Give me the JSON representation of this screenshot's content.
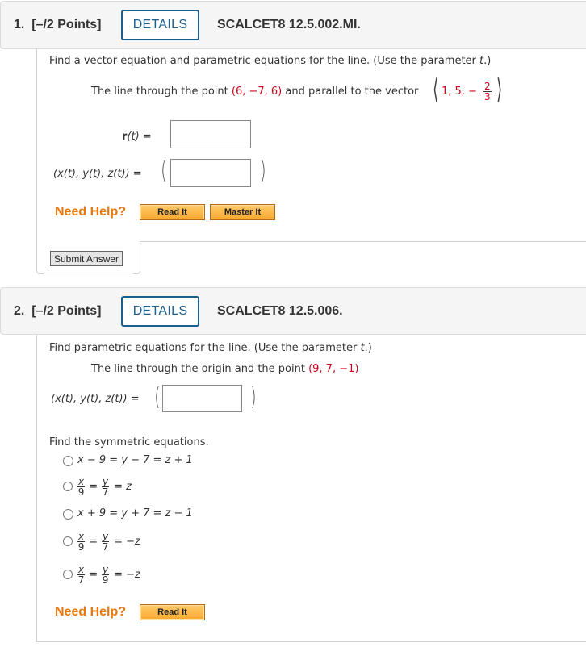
{
  "questions": [
    {
      "number": "1.",
      "points": "[–/2 Points]",
      "details_label": "DETAILS",
      "code": "SCALCET8 12.5.002.MI.",
      "instruction": "Find a vector equation and parametric equations for the line. (Use the parameter ",
      "instruction_param": "t",
      "instruction_end": ".)",
      "prompt_pre": "The line through the point ",
      "point": "(6, −7, 6)",
      "prompt_mid": " and parallel to the vector",
      "vector_parts": "1, 5, −",
      "vector_frac_num": "2",
      "vector_frac_den": "3",
      "vector_label": "r",
      "vector_label_arg": "(t) =",
      "vector_value": "",
      "param_label": "(x(t), y(t), z(t)) =",
      "param_value": "",
      "need_help": "Need Help?",
      "help_buttons": [
        "Read It",
        "Master It"
      ],
      "submit_label": "Submit Answer"
    },
    {
      "number": "2.",
      "points": "[–/2 Points]",
      "details_label": "DETAILS",
      "code": "SCALCET8 12.5.006.",
      "instruction": "Find parametric equations for the line. (Use the parameter ",
      "instruction_param": "t",
      "instruction_end": ".)",
      "prompt_pre": "The line through the origin and the point ",
      "point": "(9, 7, −1)",
      "param_label": "(x(t), y(t), z(t)) =",
      "param_value": "",
      "symmetric_prompt": "Find the symmetric equations.",
      "options": [
        {
          "text": "x − 9 = y − 7 = z + 1",
          "selected": false
        },
        {
          "frac1_num": "x",
          "frac1_den": "9",
          "frac2_num": "y",
          "frac2_den": "7",
          "rhs": "= z",
          "selected": false
        },
        {
          "text": "x + 9 = y + 7 = z − 1",
          "selected": false
        },
        {
          "frac1_num": "x",
          "frac1_den": "9",
          "frac2_num": "y",
          "frac2_den": "7",
          "rhs": "= −z",
          "selected": false
        },
        {
          "frac1_num": "x",
          "frac1_den": "7",
          "frac2_num": "y",
          "frac2_den": "9",
          "rhs": "= −z",
          "selected": false
        }
      ],
      "need_help": "Need Help?",
      "help_buttons": [
        "Read It"
      ]
    }
  ],
  "colors": {
    "accent": "#1a5f8e",
    "given_value": "#d0021b",
    "need_help": "#e8780d",
    "header_bg": "#f5f5f5"
  }
}
